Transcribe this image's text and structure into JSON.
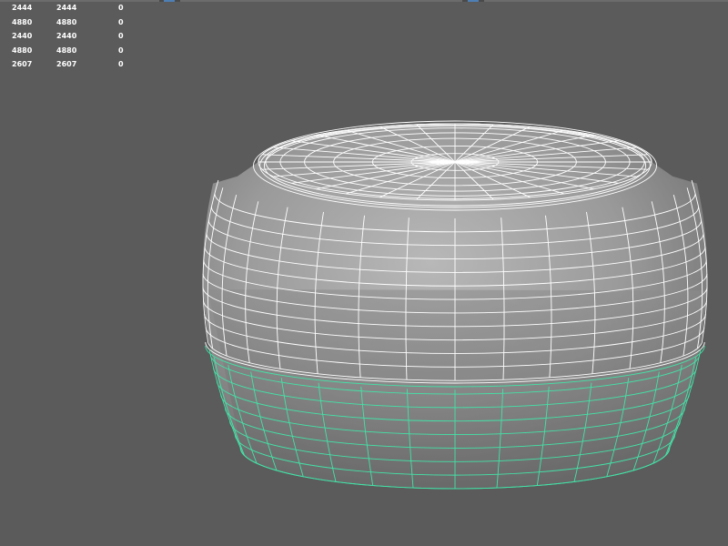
{
  "hud": {
    "poly_stats": [
      [
        "2444",
        "2444",
        "0"
      ],
      [
        "4880",
        "4880",
        "0"
      ],
      [
        "2440",
        "2440",
        "0"
      ],
      [
        "4880",
        "4880",
        "0"
      ],
      [
        "2607",
        "2607",
        "0"
      ]
    ]
  },
  "colors": {
    "viewport_bg": "#5b5b5b",
    "wire_unselected": "#ffffff",
    "wire_selected": "#43e3a8",
    "mesh_shade_light": "#b4b4b4",
    "mesh_shade_dark": "#5e5e5e",
    "hud_text": "#ffffff"
  },
  "scene": {
    "object": "rounded-cylinder-mesh",
    "selection": "lower-faces"
  }
}
